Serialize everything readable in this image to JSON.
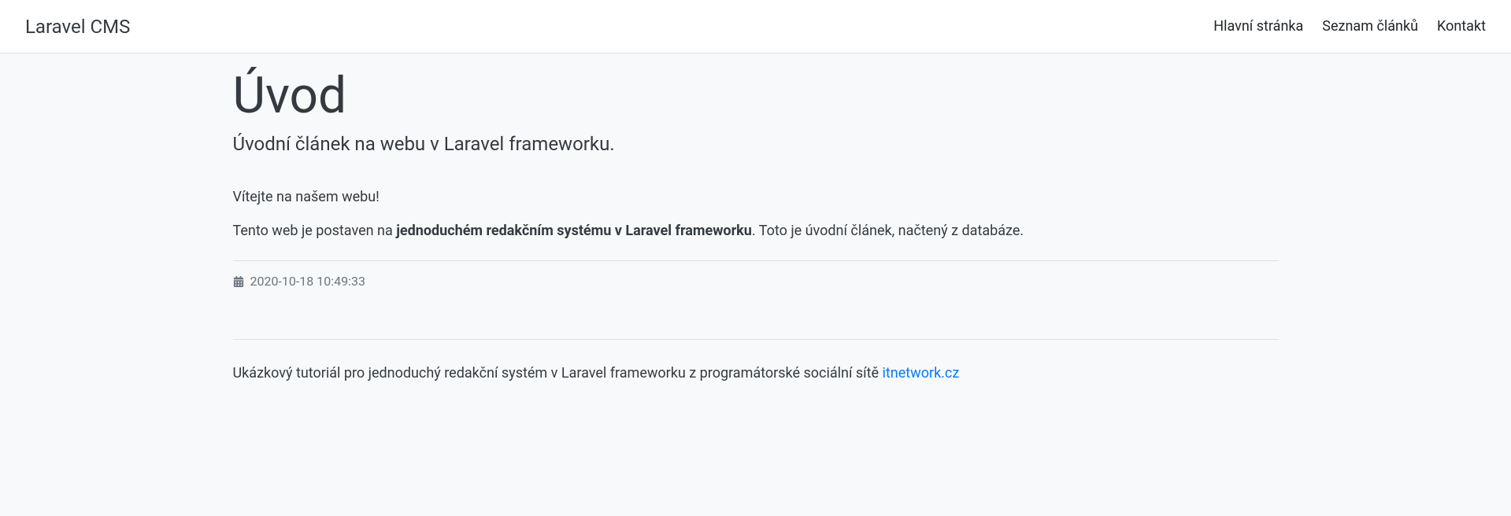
{
  "navbar": {
    "brand": "Laravel CMS",
    "links": [
      {
        "label": "Hlavní stránka"
      },
      {
        "label": "Seznam článků"
      },
      {
        "label": "Kontakt"
      }
    ]
  },
  "article": {
    "title": "Úvod",
    "subtitle": "Úvodní článek na webu v Laravel frameworku.",
    "welcome": "Vítejte na našem webu!",
    "body_prefix": "Tento web je postaven na ",
    "body_strong": "jednoduchém redakčním systému v Laravel frameworku",
    "body_suffix": ". Toto je úvodní článek, načtený z databáze.",
    "timestamp": "2020-10-18 10:49:33"
  },
  "footer": {
    "text": "Ukázkový tutoriál pro jednoduchý redakční systém v Laravel frameworku z programátorské sociální sítě ",
    "link_text": "itnetwork.cz"
  }
}
